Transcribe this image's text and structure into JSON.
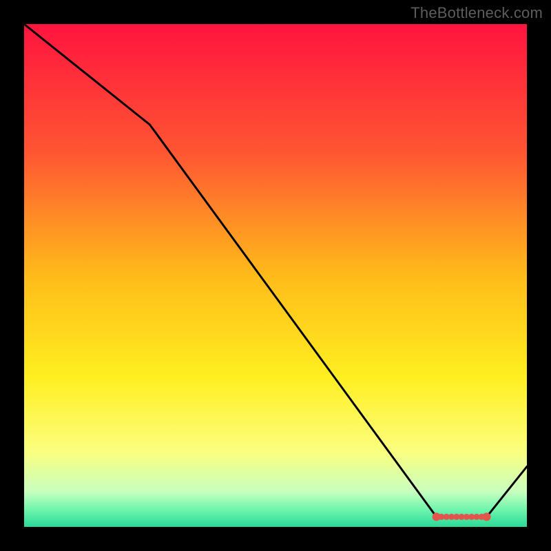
{
  "watermark": "TheBottleneck.com",
  "chart_data": {
    "type": "line",
    "title": "",
    "xlabel": "",
    "ylabel": "",
    "xlim": [
      0,
      100
    ],
    "ylim": [
      0,
      100
    ],
    "x": [
      0,
      25,
      82,
      92,
      100
    ],
    "values": [
      100,
      80,
      2,
      2,
      12
    ],
    "markers": {
      "x": [
        82,
        83,
        84,
        85,
        86,
        87,
        88,
        89,
        90,
        91,
        92
      ],
      "y": [
        2,
        2,
        2,
        2,
        2,
        2,
        2,
        2,
        2,
        2,
        2
      ],
      "color": "#e2554a"
    },
    "gradient_stops": [
      {
        "offset": 0.0,
        "color": "#ff143f"
      },
      {
        "offset": 0.25,
        "color": "#ff5433"
      },
      {
        "offset": 0.5,
        "color": "#ffbb1a"
      },
      {
        "offset": 0.7,
        "color": "#ffee20"
      },
      {
        "offset": 0.85,
        "color": "#fbff7f"
      },
      {
        "offset": 0.93,
        "color": "#c8ffbf"
      },
      {
        "offset": 0.965,
        "color": "#70f5ad"
      },
      {
        "offset": 1.0,
        "color": "#2bd998"
      }
    ]
  }
}
